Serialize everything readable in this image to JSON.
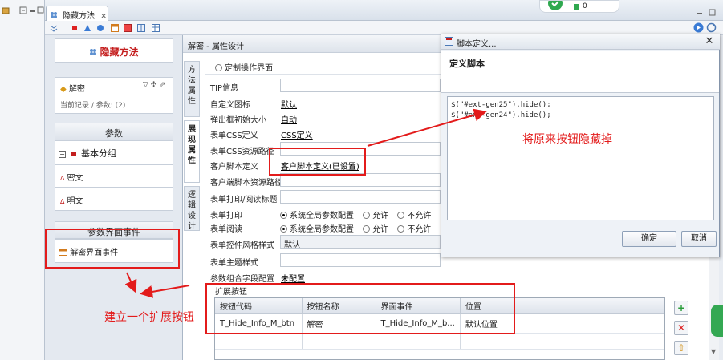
{
  "editor": {
    "tab_title": "隐藏方法",
    "tab_close": "✕"
  },
  "notification": {
    "count": "0"
  },
  "left": {
    "method_title": "隐藏方法",
    "method_item": "解密",
    "method_sub": "当前记录 / 参数: (2)",
    "params_header": "参数",
    "group_label": "基本分组",
    "param_items": [
      "密文",
      "明文"
    ],
    "events_header": "参数界面事件",
    "event_item": "解密界面事件"
  },
  "content": {
    "title": "解密 - 属性设计",
    "vtabs": [
      "方法属性",
      "展现属性",
      "逻辑设计"
    ],
    "custom_ui_radio": "定制操作界面",
    "rows": {
      "tip": "TIP信息",
      "icon": "自定义图标",
      "icon_value": "默认",
      "popup_size": "弹出框初始大小",
      "popup_value": "自动",
      "css_def": "表单CSS定义",
      "css_value": "CSS定义",
      "css_path": "表单CSS资源路径",
      "client_script": "客户脚本定义",
      "client_script_value": "客户脚本定义(已设置)",
      "client_res": "客户端脚本资源路径",
      "print_title": "表单打印/阅读标题",
      "print": "表单打印",
      "read": "表单阅读",
      "opt_global": "系统全局参数配置",
      "opt_allow": "允许",
      "opt_deny": "不允许",
      "ctrl_style": "表单控件风格样式",
      "ctrl_style_value": "默认",
      "theme_style": "表单主题样式",
      "param_combo": "参数组合字段配置",
      "param_combo_value": "未配置"
    },
    "ext_label": "扩展按钮",
    "table": {
      "headers": [
        "按钮代码",
        "按钮名称",
        "界面事件",
        "位置"
      ],
      "rows": [
        [
          "T_Hide_Info_M_btn",
          "解密",
          "T_Hide_Info_M_b...",
          "默认位置"
        ]
      ]
    }
  },
  "dialog": {
    "title": "脚本定义...",
    "header": "定义脚本",
    "script_lines": [
      "$(\"#ext-gen25\").hide();",
      "$(\"#ext-gen24\").hide();"
    ],
    "ok": "确定",
    "cancel": "取消"
  },
  "annotations": {
    "hide_note": "将原来按钮隐藏掉",
    "create_note": "建立一个扩展按钮"
  },
  "colors": {
    "annotation": "#e31b1b",
    "method_title": "#c41e1e"
  }
}
